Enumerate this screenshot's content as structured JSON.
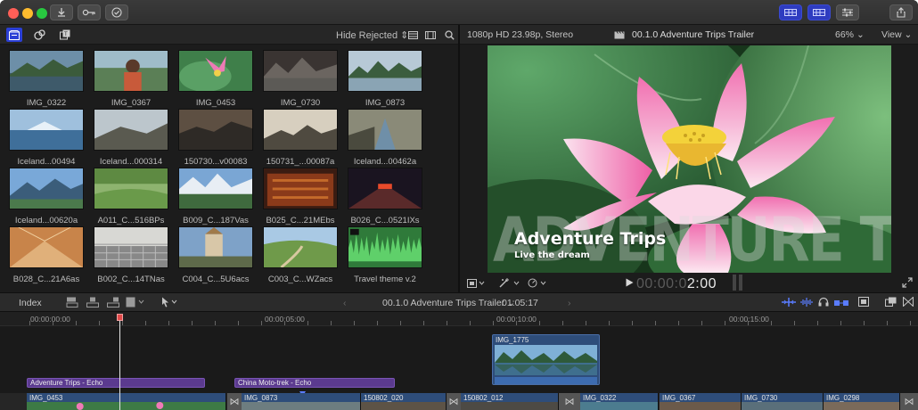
{
  "window": {
    "traffic_lights": [
      "close",
      "minimize",
      "zoom"
    ],
    "toolbar_icons": [
      "import-icon",
      "keywords-icon",
      "checkmark-icon",
      "browser-layout-icon",
      "viewer-layout-icon",
      "inspector-icon",
      "share-icon"
    ]
  },
  "browser": {
    "library_icons": [
      "libraries-icon",
      "photos-audio-icon",
      "titles-generators-icon"
    ],
    "filter": "Hide Rejected",
    "clips": [
      {
        "name": "IMG_0322"
      },
      {
        "name": "IMG_0367"
      },
      {
        "name": "IMG_0453"
      },
      {
        "name": "IMG_0730"
      },
      {
        "name": "IMG_0873"
      },
      {
        "name": "Iceland...00494"
      },
      {
        "name": "Iceland...000314"
      },
      {
        "name": "150730...v00083"
      },
      {
        "name": "150731_...00087a"
      },
      {
        "name": "Iceland...00462a"
      },
      {
        "name": "Iceland...00620a"
      },
      {
        "name": "A011_C...516BPs"
      },
      {
        "name": "B009_C...187Vas"
      },
      {
        "name": "B025_C...21MEbs"
      },
      {
        "name": "B026_C...0521IXs"
      },
      {
        "name": "B028_C...21A6as"
      },
      {
        "name": "B002_C...14TNas"
      },
      {
        "name": "C004_C...5U6acs"
      },
      {
        "name": "C003_C...WZacs"
      },
      {
        "name": "Travel theme v.2"
      }
    ]
  },
  "viewer": {
    "format": "1080p HD 23.98p, Stereo",
    "project_title": "00.1.0 Adventure Trips Trailer",
    "zoom": "66%",
    "view_menu": "View",
    "overlay_big": "ADVENTURE TRIPS",
    "overlay_title": "Adventure Trips",
    "overlay_subtitle": "Live the dream",
    "timecode_dim": "00:00:0",
    "timecode_bright": "2:00"
  },
  "timeline_toolbar": {
    "index_label": "Index",
    "project": "00.1.0 Adventure Trips Trailer",
    "duration": "01:05:17"
  },
  "timeline": {
    "ruler": [
      "00:00:00:00",
      "00:00:05:00",
      "00:00:10:00",
      "00:00:15:00"
    ],
    "connected_clip": "IMG_1775",
    "audio_clips": [
      "Adventure Trips - Echo",
      "China Moto-trek - Echo"
    ],
    "storyline": [
      "IMG_0453",
      "IMG_0873",
      "150802_020",
      "150802_012",
      "IMG_0322",
      "IMG_0367",
      "IMG_0730",
      "IMG_0298"
    ]
  },
  "colors": {
    "accent_blue": "#2b3fd6",
    "clip_blue": "#2e4d7a",
    "audio_purple": "#5b3a8f",
    "background": "#1e1e1e"
  }
}
